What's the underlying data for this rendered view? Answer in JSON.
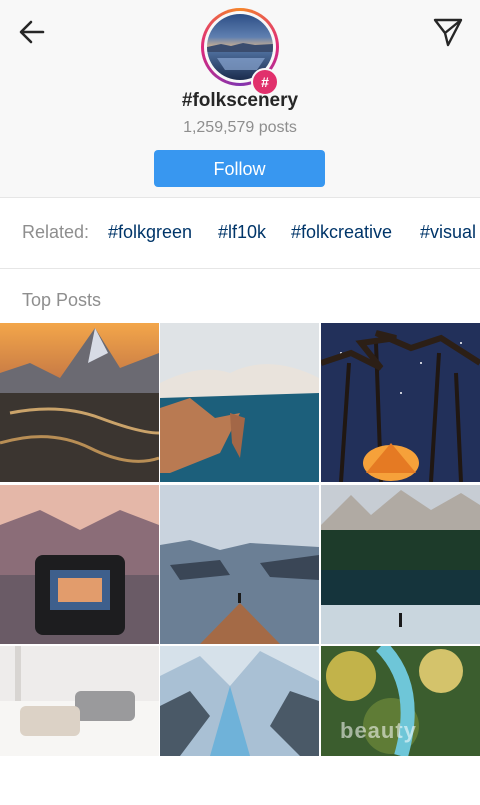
{
  "header": {
    "back_icon": "arrow-left-icon",
    "send_icon": "paper-plane-icon",
    "hashtag": "#folkscenery",
    "post_count": "1,259,579 posts",
    "follow_label": "Follow",
    "badge_symbol": "#"
  },
  "related": {
    "label": "Related:",
    "tags": [
      "#folkgreen",
      "#lf10k",
      "#folkcreative",
      "#visual"
    ]
  },
  "top_posts": {
    "label": "Top Posts"
  },
  "watermark": "beauty",
  "colors": {
    "follow_button": "#3897f0",
    "related_tag": "#003569",
    "muted_text": "#8e8e8e"
  }
}
